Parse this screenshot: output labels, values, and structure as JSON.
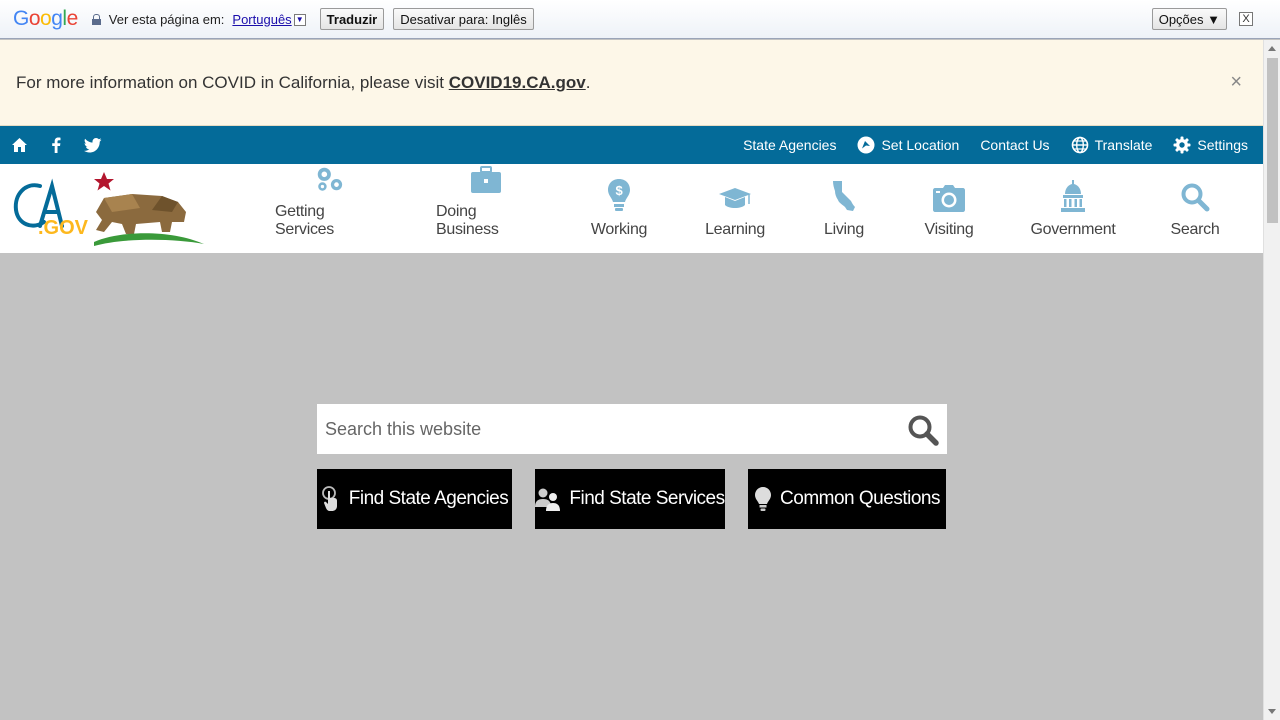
{
  "google_translate_bar": {
    "logo": "Google",
    "prompt": "Ver esta página em:",
    "language": "Português",
    "translate_button": "Traduzir",
    "disable_button": "Desativar para: Inglês",
    "options_button": "Opções ▼",
    "close_label": "X"
  },
  "alert": {
    "text": "For more information on COVID in California, please visit ",
    "link": "COVID19.CA.gov",
    "suffix": ".",
    "close": "×"
  },
  "utility_bar": {
    "links": [
      "State Agencies",
      "Set Location",
      "Contact Us",
      "Translate",
      "Settings"
    ]
  },
  "logo": {
    "text": "CA.GOV"
  },
  "nav": {
    "items": [
      {
        "label": "Getting Services",
        "icon": "gears-icon"
      },
      {
        "label": "Doing Business",
        "icon": "briefcase-icon"
      },
      {
        "label": "Working",
        "icon": "lightbulb-dollar-icon"
      },
      {
        "label": "Learning",
        "icon": "graduation-cap-icon"
      },
      {
        "label": "Living",
        "icon": "california-icon"
      },
      {
        "label": "Visiting",
        "icon": "camera-icon"
      },
      {
        "label": "Government",
        "icon": "capitol-icon"
      },
      {
        "label": "Search",
        "icon": "search-icon"
      }
    ]
  },
  "search": {
    "placeholder": "Search this website"
  },
  "quick_buttons": [
    "Find State Agencies",
    "Find State Services",
    "Common Questions"
  ],
  "colors": {
    "utility_bar": "#046b99",
    "nav_icon": "#7fb6d3",
    "alert_bg": "#fdf7e8",
    "page_bg": "#c2c2c2"
  }
}
